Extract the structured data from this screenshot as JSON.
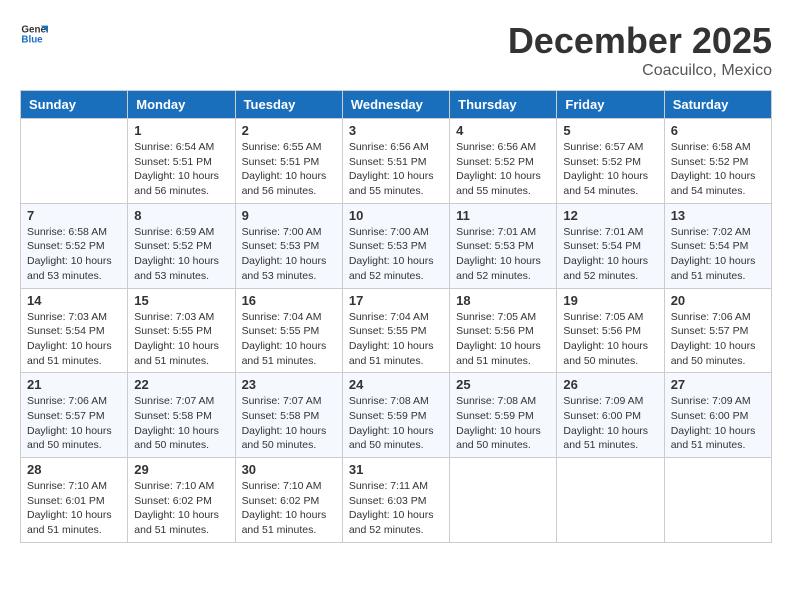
{
  "logo": {
    "general": "General",
    "blue": "Blue"
  },
  "title": "December 2025",
  "location": "Coacuilco, Mexico",
  "days_of_week": [
    "Sunday",
    "Monday",
    "Tuesday",
    "Wednesday",
    "Thursday",
    "Friday",
    "Saturday"
  ],
  "weeks": [
    [
      {
        "day": "",
        "sunrise": "",
        "sunset": "",
        "daylight": ""
      },
      {
        "day": "1",
        "sunrise": "Sunrise: 6:54 AM",
        "sunset": "Sunset: 5:51 PM",
        "daylight": "Daylight: 10 hours and 56 minutes."
      },
      {
        "day": "2",
        "sunrise": "Sunrise: 6:55 AM",
        "sunset": "Sunset: 5:51 PM",
        "daylight": "Daylight: 10 hours and 56 minutes."
      },
      {
        "day": "3",
        "sunrise": "Sunrise: 6:56 AM",
        "sunset": "Sunset: 5:51 PM",
        "daylight": "Daylight: 10 hours and 55 minutes."
      },
      {
        "day": "4",
        "sunrise": "Sunrise: 6:56 AM",
        "sunset": "Sunset: 5:52 PM",
        "daylight": "Daylight: 10 hours and 55 minutes."
      },
      {
        "day": "5",
        "sunrise": "Sunrise: 6:57 AM",
        "sunset": "Sunset: 5:52 PM",
        "daylight": "Daylight: 10 hours and 54 minutes."
      },
      {
        "day": "6",
        "sunrise": "Sunrise: 6:58 AM",
        "sunset": "Sunset: 5:52 PM",
        "daylight": "Daylight: 10 hours and 54 minutes."
      }
    ],
    [
      {
        "day": "7",
        "sunrise": "Sunrise: 6:58 AM",
        "sunset": "Sunset: 5:52 PM",
        "daylight": "Daylight: 10 hours and 53 minutes."
      },
      {
        "day": "8",
        "sunrise": "Sunrise: 6:59 AM",
        "sunset": "Sunset: 5:52 PM",
        "daylight": "Daylight: 10 hours and 53 minutes."
      },
      {
        "day": "9",
        "sunrise": "Sunrise: 7:00 AM",
        "sunset": "Sunset: 5:53 PM",
        "daylight": "Daylight: 10 hours and 53 minutes."
      },
      {
        "day": "10",
        "sunrise": "Sunrise: 7:00 AM",
        "sunset": "Sunset: 5:53 PM",
        "daylight": "Daylight: 10 hours and 52 minutes."
      },
      {
        "day": "11",
        "sunrise": "Sunrise: 7:01 AM",
        "sunset": "Sunset: 5:53 PM",
        "daylight": "Daylight: 10 hours and 52 minutes."
      },
      {
        "day": "12",
        "sunrise": "Sunrise: 7:01 AM",
        "sunset": "Sunset: 5:54 PM",
        "daylight": "Daylight: 10 hours and 52 minutes."
      },
      {
        "day": "13",
        "sunrise": "Sunrise: 7:02 AM",
        "sunset": "Sunset: 5:54 PM",
        "daylight": "Daylight: 10 hours and 51 minutes."
      }
    ],
    [
      {
        "day": "14",
        "sunrise": "Sunrise: 7:03 AM",
        "sunset": "Sunset: 5:54 PM",
        "daylight": "Daylight: 10 hours and 51 minutes."
      },
      {
        "day": "15",
        "sunrise": "Sunrise: 7:03 AM",
        "sunset": "Sunset: 5:55 PM",
        "daylight": "Daylight: 10 hours and 51 minutes."
      },
      {
        "day": "16",
        "sunrise": "Sunrise: 7:04 AM",
        "sunset": "Sunset: 5:55 PM",
        "daylight": "Daylight: 10 hours and 51 minutes."
      },
      {
        "day": "17",
        "sunrise": "Sunrise: 7:04 AM",
        "sunset": "Sunset: 5:55 PM",
        "daylight": "Daylight: 10 hours and 51 minutes."
      },
      {
        "day": "18",
        "sunrise": "Sunrise: 7:05 AM",
        "sunset": "Sunset: 5:56 PM",
        "daylight": "Daylight: 10 hours and 51 minutes."
      },
      {
        "day": "19",
        "sunrise": "Sunrise: 7:05 AM",
        "sunset": "Sunset: 5:56 PM",
        "daylight": "Daylight: 10 hours and 50 minutes."
      },
      {
        "day": "20",
        "sunrise": "Sunrise: 7:06 AM",
        "sunset": "Sunset: 5:57 PM",
        "daylight": "Daylight: 10 hours and 50 minutes."
      }
    ],
    [
      {
        "day": "21",
        "sunrise": "Sunrise: 7:06 AM",
        "sunset": "Sunset: 5:57 PM",
        "daylight": "Daylight: 10 hours and 50 minutes."
      },
      {
        "day": "22",
        "sunrise": "Sunrise: 7:07 AM",
        "sunset": "Sunset: 5:58 PM",
        "daylight": "Daylight: 10 hours and 50 minutes."
      },
      {
        "day": "23",
        "sunrise": "Sunrise: 7:07 AM",
        "sunset": "Sunset: 5:58 PM",
        "daylight": "Daylight: 10 hours and 50 minutes."
      },
      {
        "day": "24",
        "sunrise": "Sunrise: 7:08 AM",
        "sunset": "Sunset: 5:59 PM",
        "daylight": "Daylight: 10 hours and 50 minutes."
      },
      {
        "day": "25",
        "sunrise": "Sunrise: 7:08 AM",
        "sunset": "Sunset: 5:59 PM",
        "daylight": "Daylight: 10 hours and 50 minutes."
      },
      {
        "day": "26",
        "sunrise": "Sunrise: 7:09 AM",
        "sunset": "Sunset: 6:00 PM",
        "daylight": "Daylight: 10 hours and 51 minutes."
      },
      {
        "day": "27",
        "sunrise": "Sunrise: 7:09 AM",
        "sunset": "Sunset: 6:00 PM",
        "daylight": "Daylight: 10 hours and 51 minutes."
      }
    ],
    [
      {
        "day": "28",
        "sunrise": "Sunrise: 7:10 AM",
        "sunset": "Sunset: 6:01 PM",
        "daylight": "Daylight: 10 hours and 51 minutes."
      },
      {
        "day": "29",
        "sunrise": "Sunrise: 7:10 AM",
        "sunset": "Sunset: 6:02 PM",
        "daylight": "Daylight: 10 hours and 51 minutes."
      },
      {
        "day": "30",
        "sunrise": "Sunrise: 7:10 AM",
        "sunset": "Sunset: 6:02 PM",
        "daylight": "Daylight: 10 hours and 51 minutes."
      },
      {
        "day": "31",
        "sunrise": "Sunrise: 7:11 AM",
        "sunset": "Sunset: 6:03 PM",
        "daylight": "Daylight: 10 hours and 52 minutes."
      },
      {
        "day": "",
        "sunrise": "",
        "sunset": "",
        "daylight": ""
      },
      {
        "day": "",
        "sunrise": "",
        "sunset": "",
        "daylight": ""
      },
      {
        "day": "",
        "sunrise": "",
        "sunset": "",
        "daylight": ""
      }
    ]
  ]
}
